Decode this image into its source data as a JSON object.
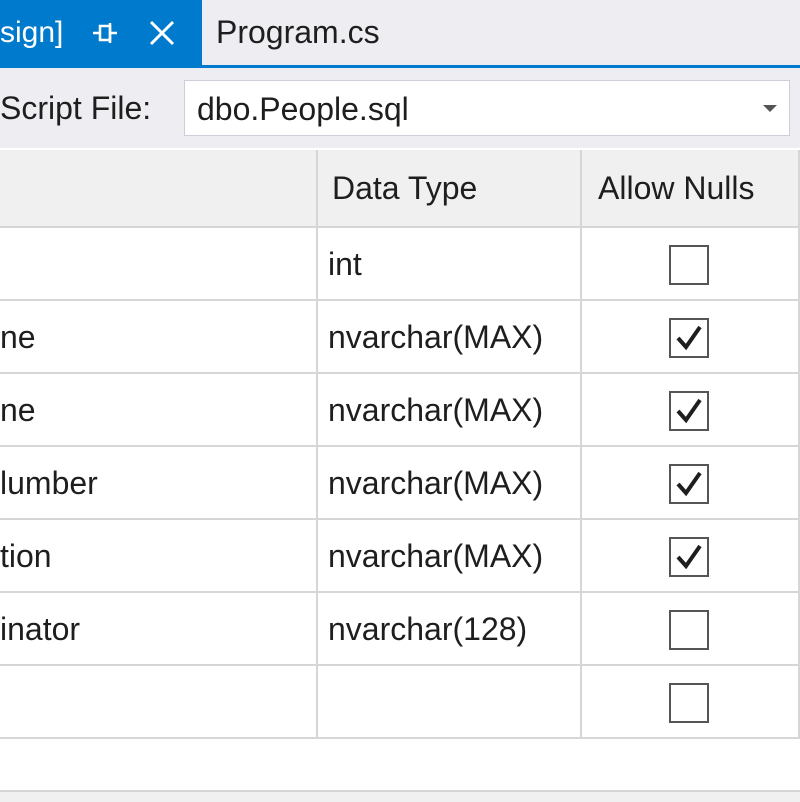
{
  "tabs": {
    "active": "sign]",
    "inactive": "Program.cs"
  },
  "script_file": {
    "label": "Script File:",
    "value": "dbo.People.sql"
  },
  "grid": {
    "headers": {
      "name": "",
      "data_type": "Data Type",
      "allow_nulls": "Allow Nulls"
    },
    "rows": [
      {
        "name": "",
        "data_type": "int",
        "allow_nulls": false
      },
      {
        "name": "ne",
        "data_type": "nvarchar(MAX)",
        "allow_nulls": true
      },
      {
        "name": "ne",
        "data_type": "nvarchar(MAX)",
        "allow_nulls": true
      },
      {
        "name": "lumber",
        "data_type": "nvarchar(MAX)",
        "allow_nulls": true
      },
      {
        "name": "tion",
        "data_type": "nvarchar(MAX)",
        "allow_nulls": true
      },
      {
        "name": "inator",
        "data_type": "nvarchar(128)",
        "allow_nulls": false
      },
      {
        "name": "",
        "data_type": "",
        "allow_nulls": false
      }
    ]
  },
  "colors": {
    "accent": "#007acc",
    "chrome": "#eeeef2",
    "grid_line": "#d6d6d6"
  }
}
